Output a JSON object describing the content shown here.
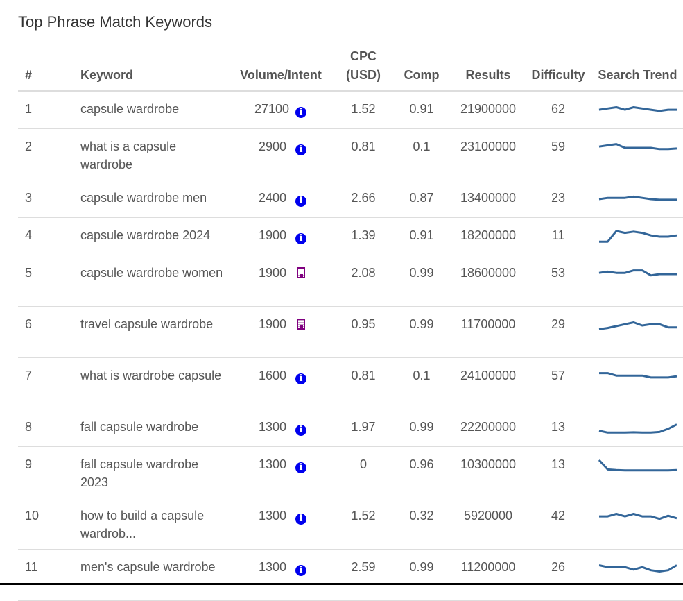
{
  "title": "Top Phrase Match Keywords",
  "columns": [
    "#",
    "Keyword",
    "Volume/Intent",
    "CPC (USD)",
    "Comp",
    "Results",
    "Difficulty",
    "Search Trend"
  ],
  "columns_display": {
    "num": "#",
    "keyword": "Keyword",
    "volume": "Volume/Intent",
    "cpc_line1": "CPC",
    "cpc_line2": "(USD)",
    "comp": "Comp",
    "results": "Results",
    "difficulty": "Difficulty",
    "trend": "Search Trend"
  },
  "colors": {
    "trend_line": "#336699",
    "info_intent": "#0000ee",
    "commercial_intent": "#800080"
  },
  "rows": [
    {
      "n": "1",
      "keyword": "capsule wardrobe",
      "volume": "27100",
      "intent": "info-icon",
      "cpc": "1.52",
      "comp": "0.91",
      "results": "21900000",
      "difficulty": "62",
      "trend": [
        0.55,
        0.65,
        0.75,
        0.55,
        0.75,
        0.65,
        0.55,
        0.45,
        0.55,
        0.55
      ]
    },
    {
      "n": "2",
      "keyword": "what is a capsule wardrobe",
      "volume": "2900",
      "intent": "info-icon",
      "cpc": "0.81",
      "comp": "0.1",
      "results": "23100000",
      "difficulty": "59",
      "trend": [
        0.6,
        0.7,
        0.8,
        0.5,
        0.5,
        0.5,
        0.5,
        0.4,
        0.4,
        0.45
      ]
    },
    {
      "n": "3",
      "keyword": "capsule wardrobe men",
      "volume": "2400",
      "intent": "info-icon",
      "cpc": "2.66",
      "comp": "0.87",
      "results": "13400000",
      "difficulty": "23",
      "trend": [
        0.5,
        0.6,
        0.6,
        0.6,
        0.7,
        0.6,
        0.5,
        0.45,
        0.45,
        0.45
      ]
    },
    {
      "n": "4",
      "keyword": "capsule wardrobe 2024",
      "volume": "1900",
      "intent": "info-icon",
      "cpc": "1.39",
      "comp": "0.91",
      "results": "18200000",
      "difficulty": "11",
      "trend": [
        0.1,
        0.1,
        0.95,
        0.8,
        0.9,
        0.8,
        0.6,
        0.5,
        0.5,
        0.6
      ]
    },
    {
      "n": "5",
      "keyword": "capsule wardrobe women",
      "volume": "1900",
      "intent": "building-icon",
      "cpc": "2.08",
      "comp": "0.99",
      "results": "18600000",
      "difficulty": "53",
      "trend": [
        0.6,
        0.7,
        0.6,
        0.6,
        0.8,
        0.8,
        0.4,
        0.5,
        0.5,
        0.5
      ]
    },
    {
      "n": "6",
      "keyword": "travel capsule wardrobe",
      "volume": "1900",
      "intent": "building-icon",
      "cpc": "0.95",
      "comp": "0.99",
      "results": "11700000",
      "difficulty": "29",
      "trend": [
        0.2,
        0.3,
        0.45,
        0.6,
        0.75,
        0.5,
        0.6,
        0.6,
        0.35,
        0.35
      ]
    },
    {
      "n": "7",
      "keyword": "what is wardrobe capsule",
      "volume": "1600",
      "intent": "info-icon",
      "cpc": "0.81",
      "comp": "0.1",
      "results": "24100000",
      "difficulty": "57",
      "trend": [
        0.8,
        0.8,
        0.6,
        0.6,
        0.6,
        0.6,
        0.45,
        0.45,
        0.45,
        0.55
      ]
    },
    {
      "n": "8",
      "keyword": "fall capsule wardrobe",
      "volume": "1300",
      "intent": "info-icon",
      "cpc": "1.97",
      "comp": "0.99",
      "results": "22200000",
      "difficulty": "13",
      "trend": [
        0.3,
        0.15,
        0.15,
        0.15,
        0.17,
        0.15,
        0.15,
        0.2,
        0.45,
        0.8
      ]
    },
    {
      "n": "9",
      "keyword": "fall capsule wardrobe 2023",
      "volume": "1300",
      "intent": "info-icon",
      "cpc": "0",
      "comp": "0.96",
      "results": "10300000",
      "difficulty": "13",
      "trend": [
        0.95,
        0.2,
        0.15,
        0.12,
        0.12,
        0.12,
        0.12,
        0.12,
        0.12,
        0.15
      ]
    },
    {
      "n": "10",
      "keyword": "how to build a capsule wardrob...",
      "volume": "1300",
      "intent": "info-icon",
      "cpc": "1.52",
      "comp": "0.32",
      "results": "5920000",
      "difficulty": "42",
      "trend": [
        0.55,
        0.55,
        0.75,
        0.55,
        0.75,
        0.55,
        0.55,
        0.35,
        0.6,
        0.4
      ]
    },
    {
      "n": "11",
      "keyword": "men's capsule wardrobe",
      "volume": "1300",
      "intent": "info-icon",
      "cpc": "2.59",
      "comp": "0.99",
      "results": "11200000",
      "difficulty": "26",
      "trend": [
        0.75,
        0.6,
        0.6,
        0.6,
        0.4,
        0.6,
        0.35,
        0.25,
        0.35,
        0.75
      ]
    }
  ]
}
